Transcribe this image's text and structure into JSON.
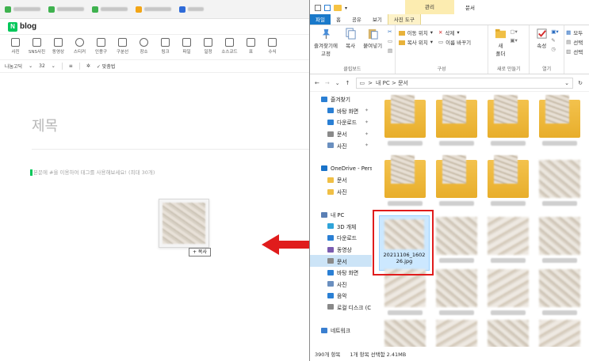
{
  "browser": {
    "tabs": [
      {
        "label": "Jeju HADAS 직..."
      },
      {
        "label": "이벤트사진 관리..."
      },
      {
        "label": "언택트가 가득할 ..."
      },
      {
        "label": "sGI 디지털 인..."
      },
      {
        "label": "사진 1..."
      }
    ]
  },
  "blog": {
    "logo": "blog",
    "toolbar": [
      {
        "label": "사진",
        "icon": "photo-icon"
      },
      {
        "label": "SNS사진",
        "icon": "sns-photo-icon"
      },
      {
        "label": "동영상",
        "icon": "video-icon"
      },
      {
        "label": "스티커",
        "icon": "sticker-icon"
      },
      {
        "label": "인용구",
        "icon": "quote-icon"
      },
      {
        "label": "구분선",
        "icon": "divider-icon"
      },
      {
        "label": "장소",
        "icon": "place-icon"
      },
      {
        "label": "링크",
        "icon": "link-icon"
      },
      {
        "label": "파일",
        "icon": "file-icon"
      },
      {
        "label": "일정",
        "icon": "schedule-icon"
      },
      {
        "label": "소스코드",
        "icon": "code-icon"
      },
      {
        "label": "표",
        "icon": "table-icon"
      },
      {
        "label": "수식",
        "icon": "formula-icon"
      }
    ],
    "format": {
      "font": "나눔고딕",
      "size": "32",
      "spell": "맞춤법"
    },
    "title_placeholder": "제목",
    "tag_hint": "본문에 #을 이용하여 태그를 사용해보세요! (최대 30개)",
    "copy_badge": "+ 복사"
  },
  "explorer": {
    "context_group": "관리",
    "window_title": "문서",
    "ribbon_tabs": [
      "파일",
      "홈",
      "공유",
      "보기",
      "사진 도구"
    ],
    "ribbon": {
      "clipboard": {
        "name": "클립보드",
        "pin": "즐겨찾기에 고정",
        "copy": "복사",
        "paste": "붙여넣기"
      },
      "organize": {
        "name": "구성",
        "move": "이동 위치",
        "copy_to": "복사 위치",
        "delete": "삭제",
        "rename": "이름 바꾸기"
      },
      "new": {
        "name": "새로 만들기",
        "new_folder": "새 폴더"
      },
      "open": {
        "name": "열기",
        "properties": "속성"
      },
      "select": {
        "all": "모두",
        "sel": "선택",
        "inv": "선택"
      }
    },
    "address": {
      "path": "내 PC  >  문서",
      "sep": ">"
    },
    "nav": [
      {
        "label": "즐겨찾기",
        "icon": "star-icon",
        "pin": false
      },
      {
        "label": "바탕 화면",
        "icon": "desktop-icon",
        "pin": true
      },
      {
        "label": "다운로드",
        "icon": "download-icon",
        "pin": true
      },
      {
        "label": "문서",
        "icon": "document-icon",
        "pin": true
      },
      {
        "label": "사진",
        "icon": "picture-icon",
        "pin": true
      },
      {
        "label": "",
        "icon": "",
        "pin": false
      },
      {
        "label": "OneDrive - Pers",
        "icon": "cloud-icon",
        "pin": false
      },
      {
        "label": "문서",
        "icon": "folder-icon",
        "pin": false
      },
      {
        "label": "사진",
        "icon": "folder-icon",
        "pin": false
      },
      {
        "label": "",
        "icon": "",
        "pin": false
      },
      {
        "label": "내 PC",
        "icon": "pc-icon",
        "pin": false
      },
      {
        "label": "3D 개체",
        "icon": "cube-icon",
        "pin": false
      },
      {
        "label": "다운로드",
        "icon": "download-icon",
        "pin": false
      },
      {
        "label": "동영상",
        "icon": "video-icon",
        "pin": false
      },
      {
        "label": "문서",
        "icon": "document-icon",
        "pin": false,
        "selected": true
      },
      {
        "label": "바탕 화면",
        "icon": "desktop-icon",
        "pin": false
      },
      {
        "label": "사진",
        "icon": "picture-icon",
        "pin": false
      },
      {
        "label": "음악",
        "icon": "music-icon",
        "pin": false
      },
      {
        "label": "로컬 디스크 (C",
        "icon": "disk-icon",
        "pin": false
      },
      {
        "label": "",
        "icon": "",
        "pin": false
      },
      {
        "label": "네트워크",
        "icon": "network-icon",
        "pin": false
      }
    ],
    "selected_file": "20211106_160226.jpg",
    "status": {
      "count": "390개 항목",
      "selection": "1개 항목 선택함 2.41MB"
    }
  }
}
